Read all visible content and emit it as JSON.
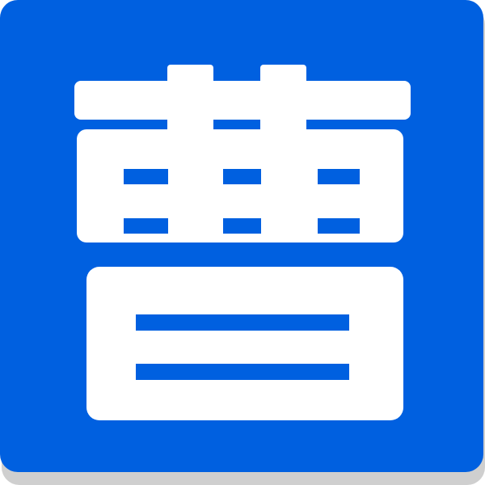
{
  "icon": {
    "glyph": "曹",
    "name": "cao-character-icon",
    "background_color": "#0060E0",
    "glyph_color": "#FFFFFF",
    "shadow_color": "#CFCFCF"
  }
}
